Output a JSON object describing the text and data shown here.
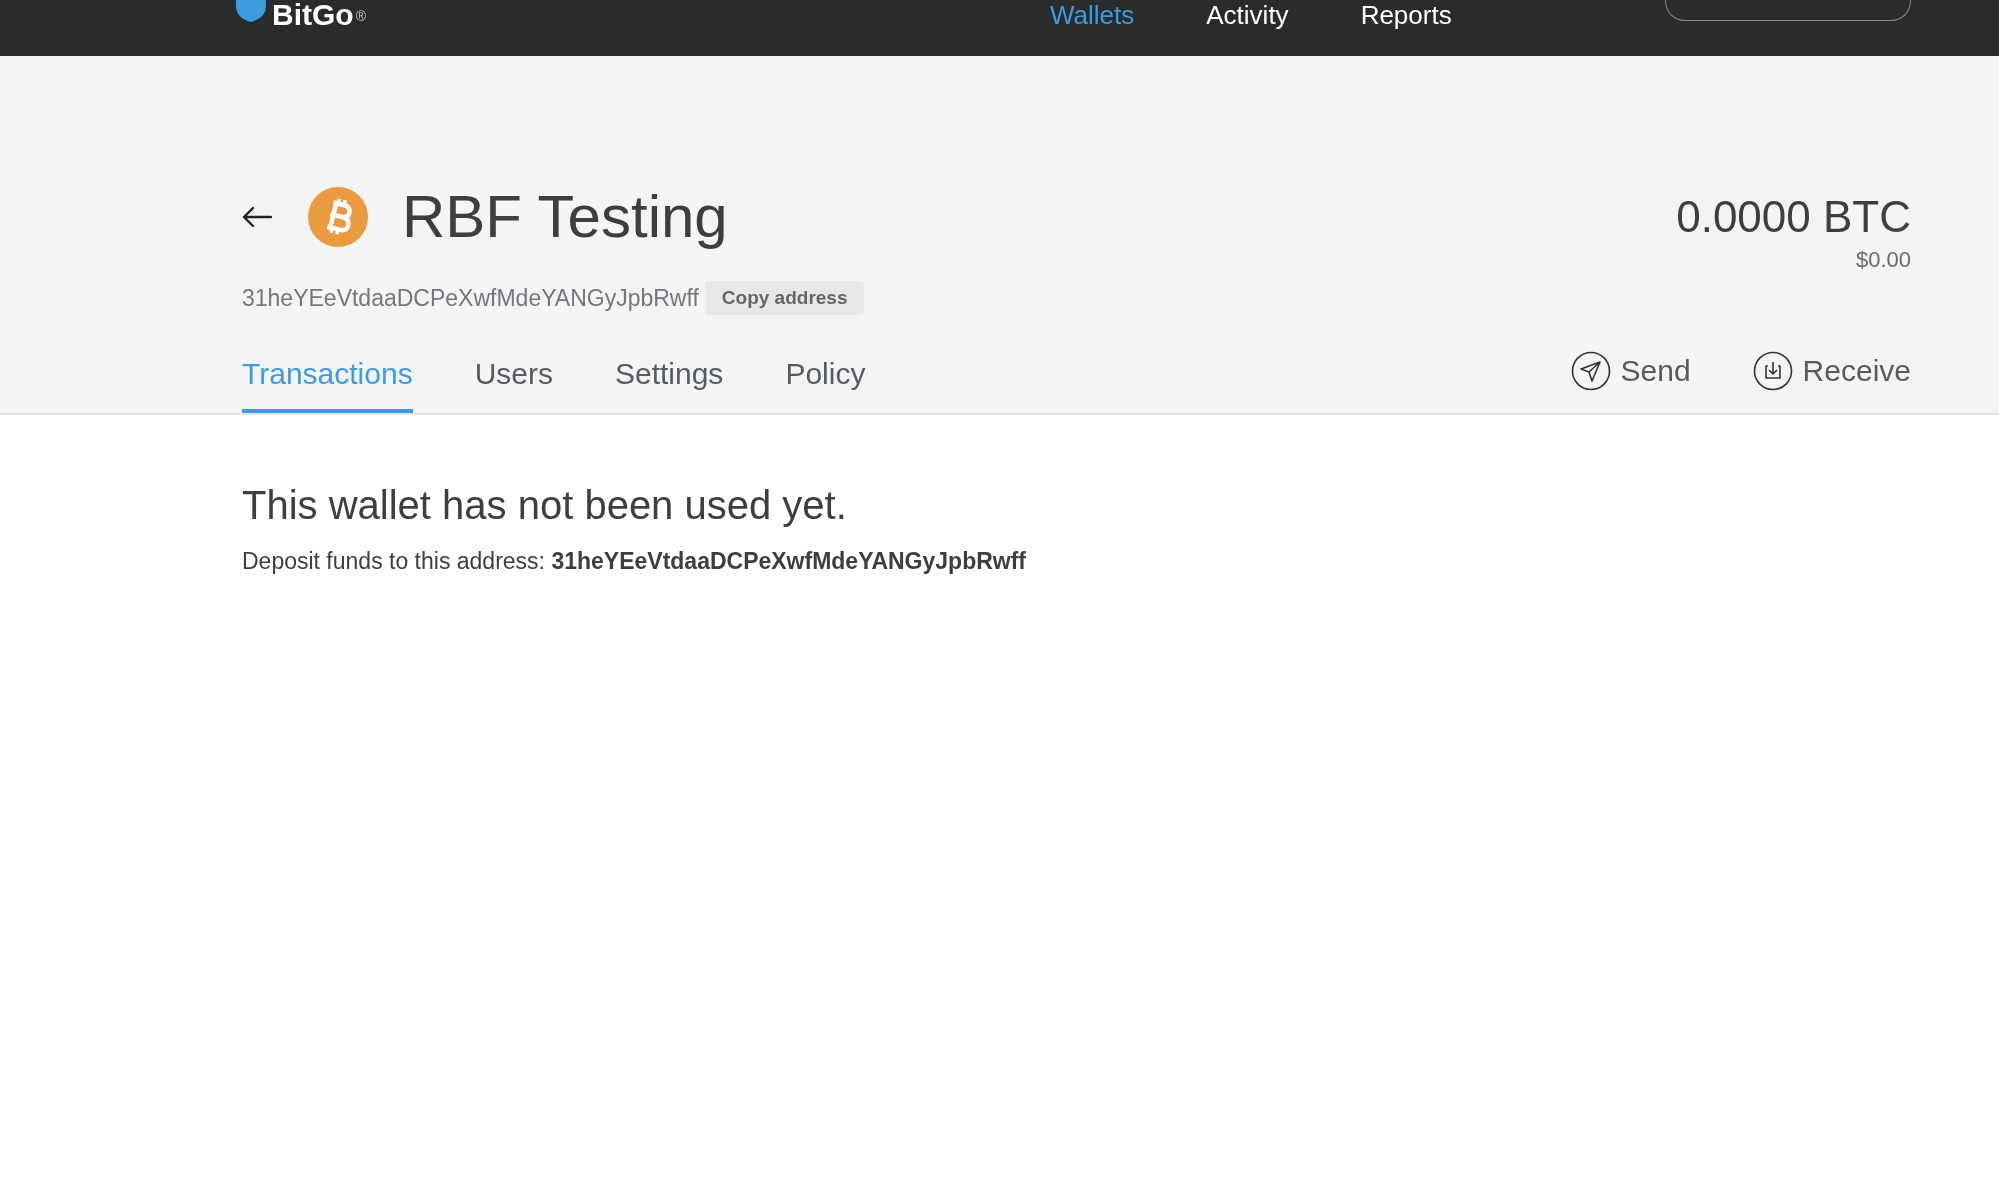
{
  "top_bar": {
    "logo": "BitGo",
    "logo_mark": "®",
    "nav": [
      {
        "label": "Wallets",
        "selected": true
      },
      {
        "label": "Activity",
        "selected": false
      },
      {
        "label": "Reports",
        "selected": false
      }
    ]
  },
  "wallet": {
    "name": "RBF Testing",
    "balance": "0.0000 BTC",
    "balance_usd": "$0.00",
    "address": "31heYEeVtdaaDCPeXwfMdeYANGyJpbRwff",
    "copy_button": "Copy address"
  },
  "tabs": [
    {
      "label": "Transactions",
      "selected": true
    },
    {
      "label": "Users",
      "selected": false
    },
    {
      "label": "Settings",
      "selected": false
    },
    {
      "label": "Policy",
      "selected": false
    }
  ],
  "actions": [
    {
      "kind": "send",
      "label": "Send"
    },
    {
      "kind": "receive",
      "label": "Receive"
    }
  ],
  "empty_state": {
    "title": "This wallet has not been used yet.",
    "text": "Deposit funds to this address: **31heYEeVtdaaDCPeXwfMdeYANGyJpbRwff**"
  }
}
